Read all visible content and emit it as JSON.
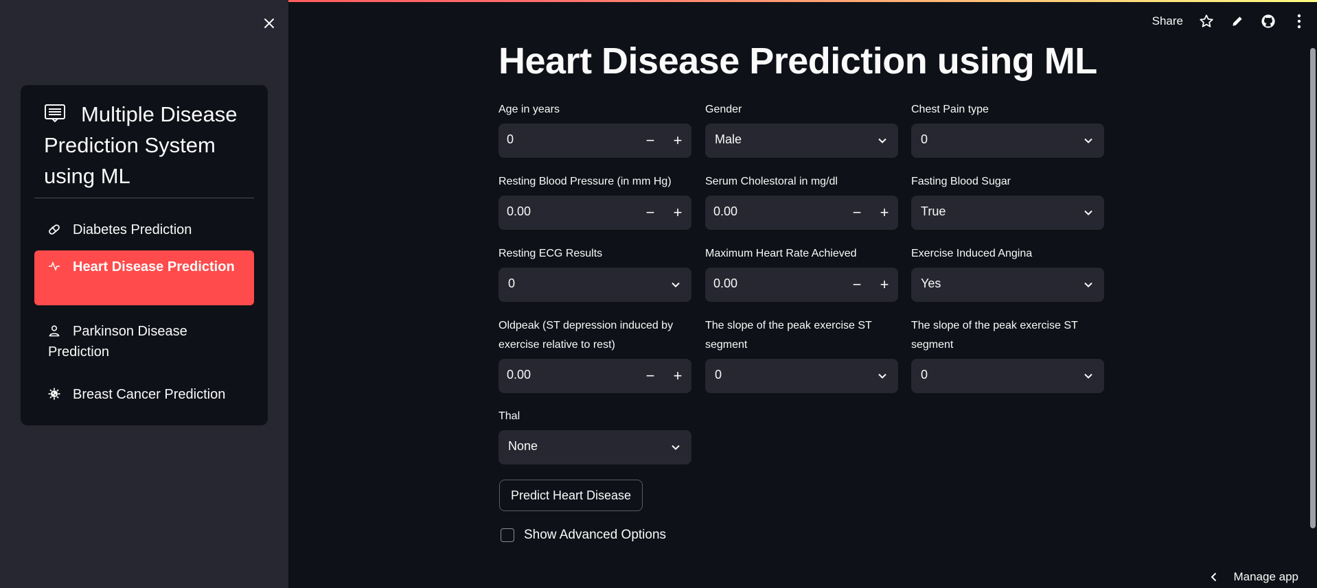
{
  "colors": {
    "accent": "#ff4b4b",
    "background": "#0e1117",
    "sidebar": "#262730",
    "input": "#262730"
  },
  "sidebar": {
    "close_icon": "close-icon",
    "menu_title": "Multiple Disease Prediction System using ML",
    "items": [
      {
        "label": "Diabetes Prediction",
        "icon": "capsule-icon",
        "active": false
      },
      {
        "label": "Heart Disease Prediction",
        "icon": "activity-icon",
        "active": true
      },
      {
        "label": "Parkinson Disease Prediction",
        "icon": "person-icon",
        "active": false
      },
      {
        "label": "Breast Cancer Prediction",
        "icon": "virus-icon",
        "active": false
      }
    ]
  },
  "toolbar": {
    "share_label": "Share"
  },
  "main": {
    "title": "Heart Disease Prediction using ML",
    "fields": {
      "age": {
        "label": "Age in years",
        "value": "0"
      },
      "gender": {
        "label": "Gender",
        "value": "Male"
      },
      "chest_pain": {
        "label": "Chest Pain type",
        "value": "0"
      },
      "resting_bp": {
        "label": "Resting Blood Pressure (in mm Hg)",
        "value": "0.00"
      },
      "cholesterol": {
        "label": "Serum Cholestoral in mg/dl",
        "value": "0.00"
      },
      "fasting_sugar": {
        "label": "Fasting Blood Sugar",
        "value": "True"
      },
      "ecg": {
        "label": "Resting ECG Results",
        "value": "0"
      },
      "max_hr": {
        "label": "Maximum Heart Rate Achieved",
        "value": "0.00"
      },
      "angina": {
        "label": "Exercise Induced Angina",
        "value": "Yes"
      },
      "oldpeak": {
        "label": "Oldpeak (ST depression induced by exercise relative to rest)",
        "value": "0.00"
      },
      "slope_a": {
        "label": "The slope of the peak exercise ST segment",
        "value": "0"
      },
      "slope_b": {
        "label": "The slope of the peak exercise ST segment",
        "value": "0"
      },
      "thal": {
        "label": "Thal",
        "value": "None"
      }
    },
    "predict_button": "Predict Heart Disease",
    "advanced_checkbox": "Show Advanced Options"
  },
  "footer": {
    "manage_app": "Manage app"
  }
}
